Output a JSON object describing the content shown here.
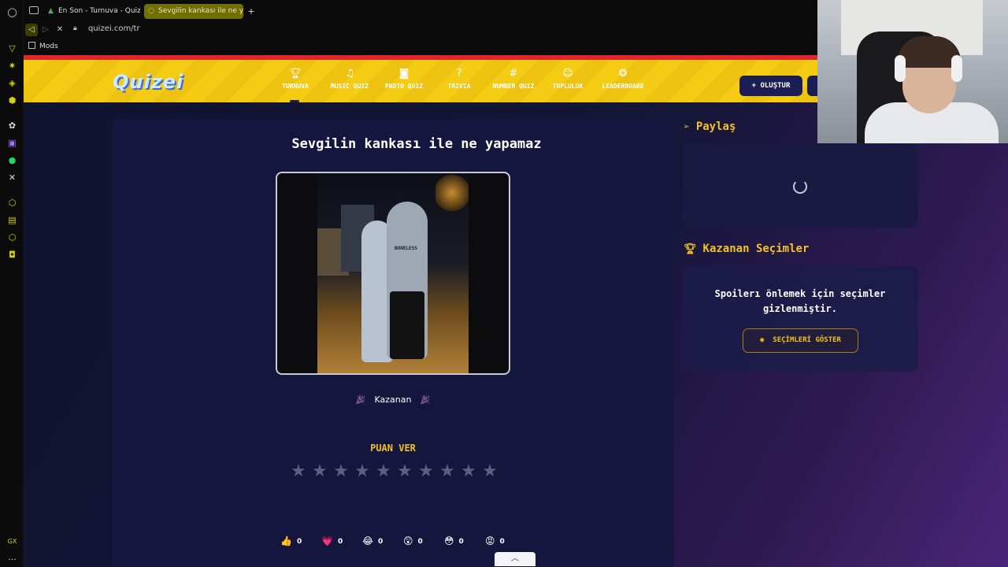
{
  "browser": {
    "tabs": [
      {
        "label": "En Son - Turnuva - Quizei",
        "icon": "quizei-favicon"
      },
      {
        "label": "Sevgilin kankası ile ne yap",
        "icon": "loading-spinner-icon"
      }
    ],
    "new_tab_label": "+",
    "url": "quizei.com/tr",
    "bookmark": "Mods",
    "sidebar_bottom_label": "GX",
    "sidebar_more": "...",
    "accent_color": "#d6d000"
  },
  "site": {
    "logo": "Quizei",
    "nav": [
      {
        "label": "TURNUVA",
        "icon": "trophy-icon",
        "active": true
      },
      {
        "label": "MUSIC QUIZ",
        "icon": "music-icon"
      },
      {
        "label": "PHOTO QUIZ",
        "icon": "camera-icon"
      },
      {
        "label": "TRIVIA",
        "icon": "question-bubble-icon"
      },
      {
        "label": "NUMBER QUIZ",
        "icon": "hash-icon"
      },
      {
        "label": "TOPLULUK",
        "icon": "users-icon"
      },
      {
        "label": "LEADERBOARD",
        "icon": "medal-icon"
      }
    ],
    "create_button": "+ OLUŞTUR",
    "header_color": "#f5cc14",
    "accent_red": "#e0262a"
  },
  "quiz": {
    "title": "Sevgilin kankası ile ne yapamaz",
    "image_alt_text": "BONELESS",
    "winner_label": "Kazanan",
    "rate_title": "PUAN VER",
    "star_count": 10,
    "rating": 0,
    "reactions": [
      {
        "icon": "thumbs-up-icon",
        "glyph": "👍",
        "count": "0"
      },
      {
        "icon": "heart-icon",
        "glyph": "💗",
        "count": "0"
      },
      {
        "icon": "laugh-icon",
        "glyph": "😂",
        "count": "0"
      },
      {
        "icon": "shocked-icon",
        "glyph": "😲",
        "count": "0"
      },
      {
        "icon": "flushed-icon",
        "glyph": "😳",
        "count": "0"
      },
      {
        "icon": "angry-icon",
        "glyph": "😡",
        "count": "0"
      }
    ]
  },
  "side": {
    "share_title": "Paylaş",
    "winners_title": "Kazanan Seçimler",
    "spoiler_text": "Spoilerı önlemek için seçimler gizlenmiştir.",
    "show_button": "SEÇİMLERİ GÖSTER",
    "accent_yellow": "#f2c221"
  }
}
